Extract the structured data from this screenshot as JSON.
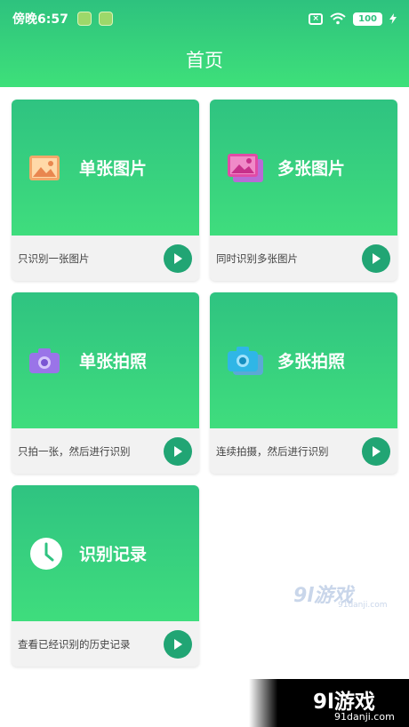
{
  "status_bar": {
    "time": "傍晚6:57",
    "battery": "100"
  },
  "header": {
    "title": "首页"
  },
  "cards": [
    {
      "label": "单张图片",
      "description": "只识别一张图片",
      "icon": "image-icon"
    },
    {
      "label": "多张图片",
      "description": "同时识别多张图片",
      "icon": "images-icon"
    },
    {
      "label": "单张拍照",
      "description": "只拍一张，然后进行识别",
      "icon": "camera-icon"
    },
    {
      "label": "多张拍照",
      "description": "连续拍摄，然后进行识别",
      "icon": "multi-camera-icon"
    },
    {
      "label": "识别记录",
      "description": "查看已经识别的历史记录",
      "icon": "clock-icon"
    }
  ],
  "watermark": {
    "brand": "9l游戏",
    "site": "91danji.com"
  },
  "colors": {
    "header_green": "#2ec27e",
    "card_green": "#3fdd7d",
    "play_button": "#21a574"
  }
}
